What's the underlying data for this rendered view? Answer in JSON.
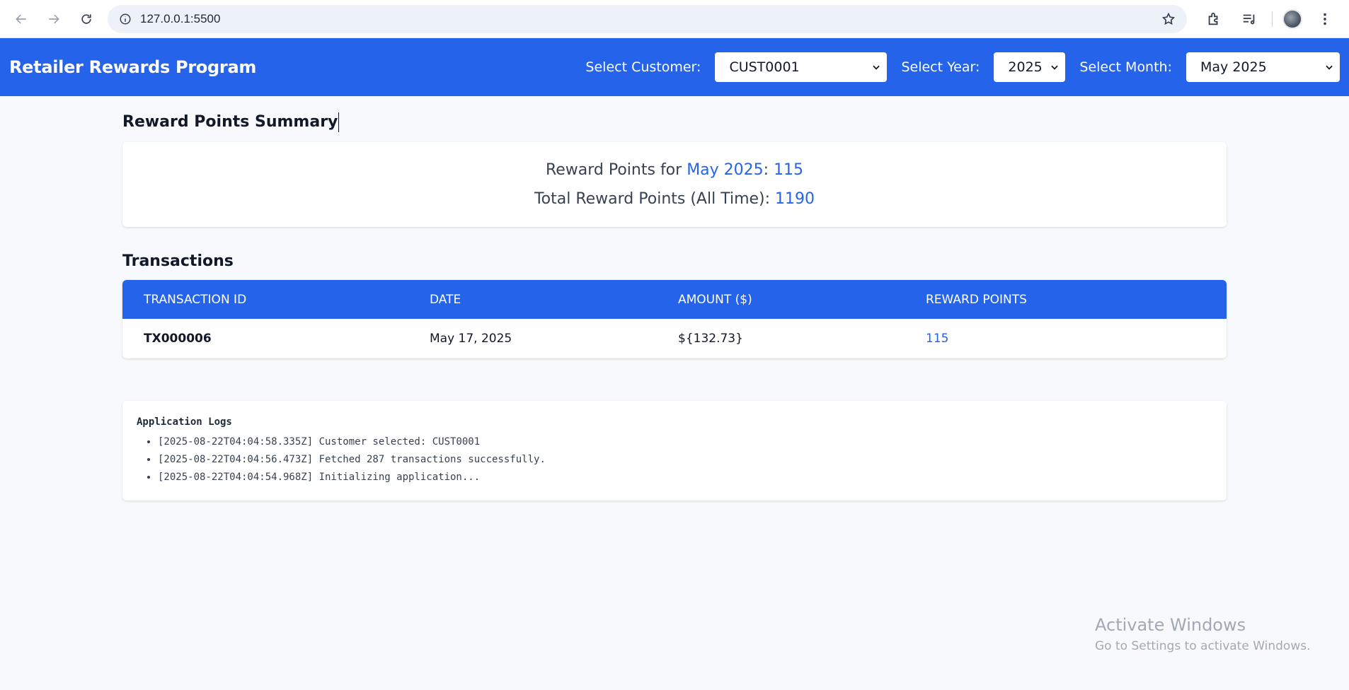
{
  "browser": {
    "url": "127.0.0.1:5500"
  },
  "header": {
    "title": "Retailer Rewards Program",
    "customer_label": "Select Customer:",
    "customer_value": "CUST0001",
    "year_label": "Select Year:",
    "year_value": "2025",
    "month_label": "Select Month:",
    "month_value": "May 2025"
  },
  "summary": {
    "title": "Reward Points Summary",
    "month_prefix": "Reward Points for ",
    "month_name": "May 2025",
    "month_sep": ": ",
    "month_points": "115",
    "total_prefix": "Total Reward Points (All Time): ",
    "total_points": "1190"
  },
  "transactions": {
    "title": "Transactions",
    "columns": [
      "Transaction ID",
      "Date",
      "Amount ($)",
      "Reward Points"
    ],
    "rows": [
      {
        "id": "TX000006",
        "date": "May 17, 2025",
        "amount": "${132.73}",
        "points": "115"
      }
    ]
  },
  "logs": {
    "title": "Application Logs",
    "entries": [
      "[2025-08-22T04:04:58.335Z] Customer selected: CUST0001",
      "[2025-08-22T04:04:56.473Z] Fetched 287 transactions successfully.",
      "[2025-08-22T04:04:54.968Z] Initializing application..."
    ]
  },
  "watermark": {
    "title": "Activate Windows",
    "subtitle": "Go to Settings to activate Windows."
  },
  "colors": {
    "brand": "#2563eb",
    "page_bg": "#f7f9fc"
  }
}
